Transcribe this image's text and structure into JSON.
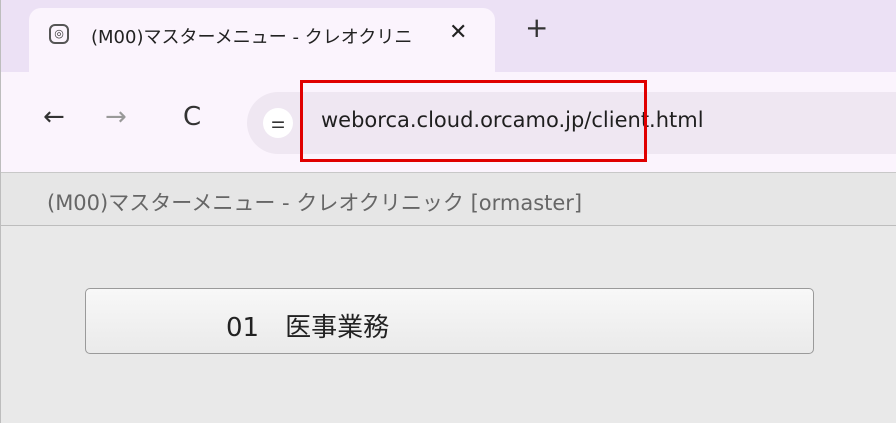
{
  "browser": {
    "tab": {
      "favicon": "clinic-favicon",
      "title": "(M00)マスターメニュー - クレオクリニ",
      "close": "✕"
    },
    "new_tab": "+",
    "nav": {
      "back": "←",
      "forward": "→",
      "reload": "C"
    },
    "site_info_icon": "tune-icon",
    "url_host": "weborca.cloud.orcamo.jp/",
    "url_path": "client.html",
    "highlight_color": "#e00000"
  },
  "page": {
    "header": "(M00)マスターメニュー - クレオクリニック [ormaster]",
    "menu_button": "01　医事業務"
  }
}
